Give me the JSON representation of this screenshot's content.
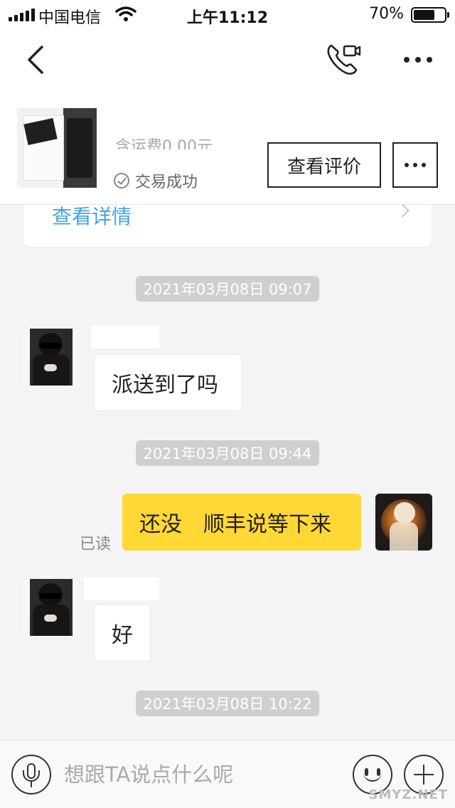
{
  "status_bar": {
    "carrier": "中国电信",
    "time": "上午11:12",
    "battery_percent": "70%",
    "battery_level": 0.7
  },
  "nav": {
    "back_icon": "chevron-left-icon",
    "call_icon": "phone-video-icon",
    "more_icon": "more-dots-icon"
  },
  "product": {
    "price_text": "含运费0.00元",
    "status_text": "交易成功",
    "review_button": "查看评价"
  },
  "order_detail": {
    "link_text": "查看详情"
  },
  "messages": {
    "ts1": "2021年03月08日 09:07",
    "msg1": "派送到了吗",
    "ts2": "2021年03月08日 09:44",
    "msg2": "还没　顺丰说等下来",
    "read_status": "已读",
    "msg3": "好",
    "ts3": "2021年03月08日 10:22"
  },
  "input": {
    "placeholder": "想跟TA说点什么呢"
  },
  "watermark": "SMYZ.NET"
}
